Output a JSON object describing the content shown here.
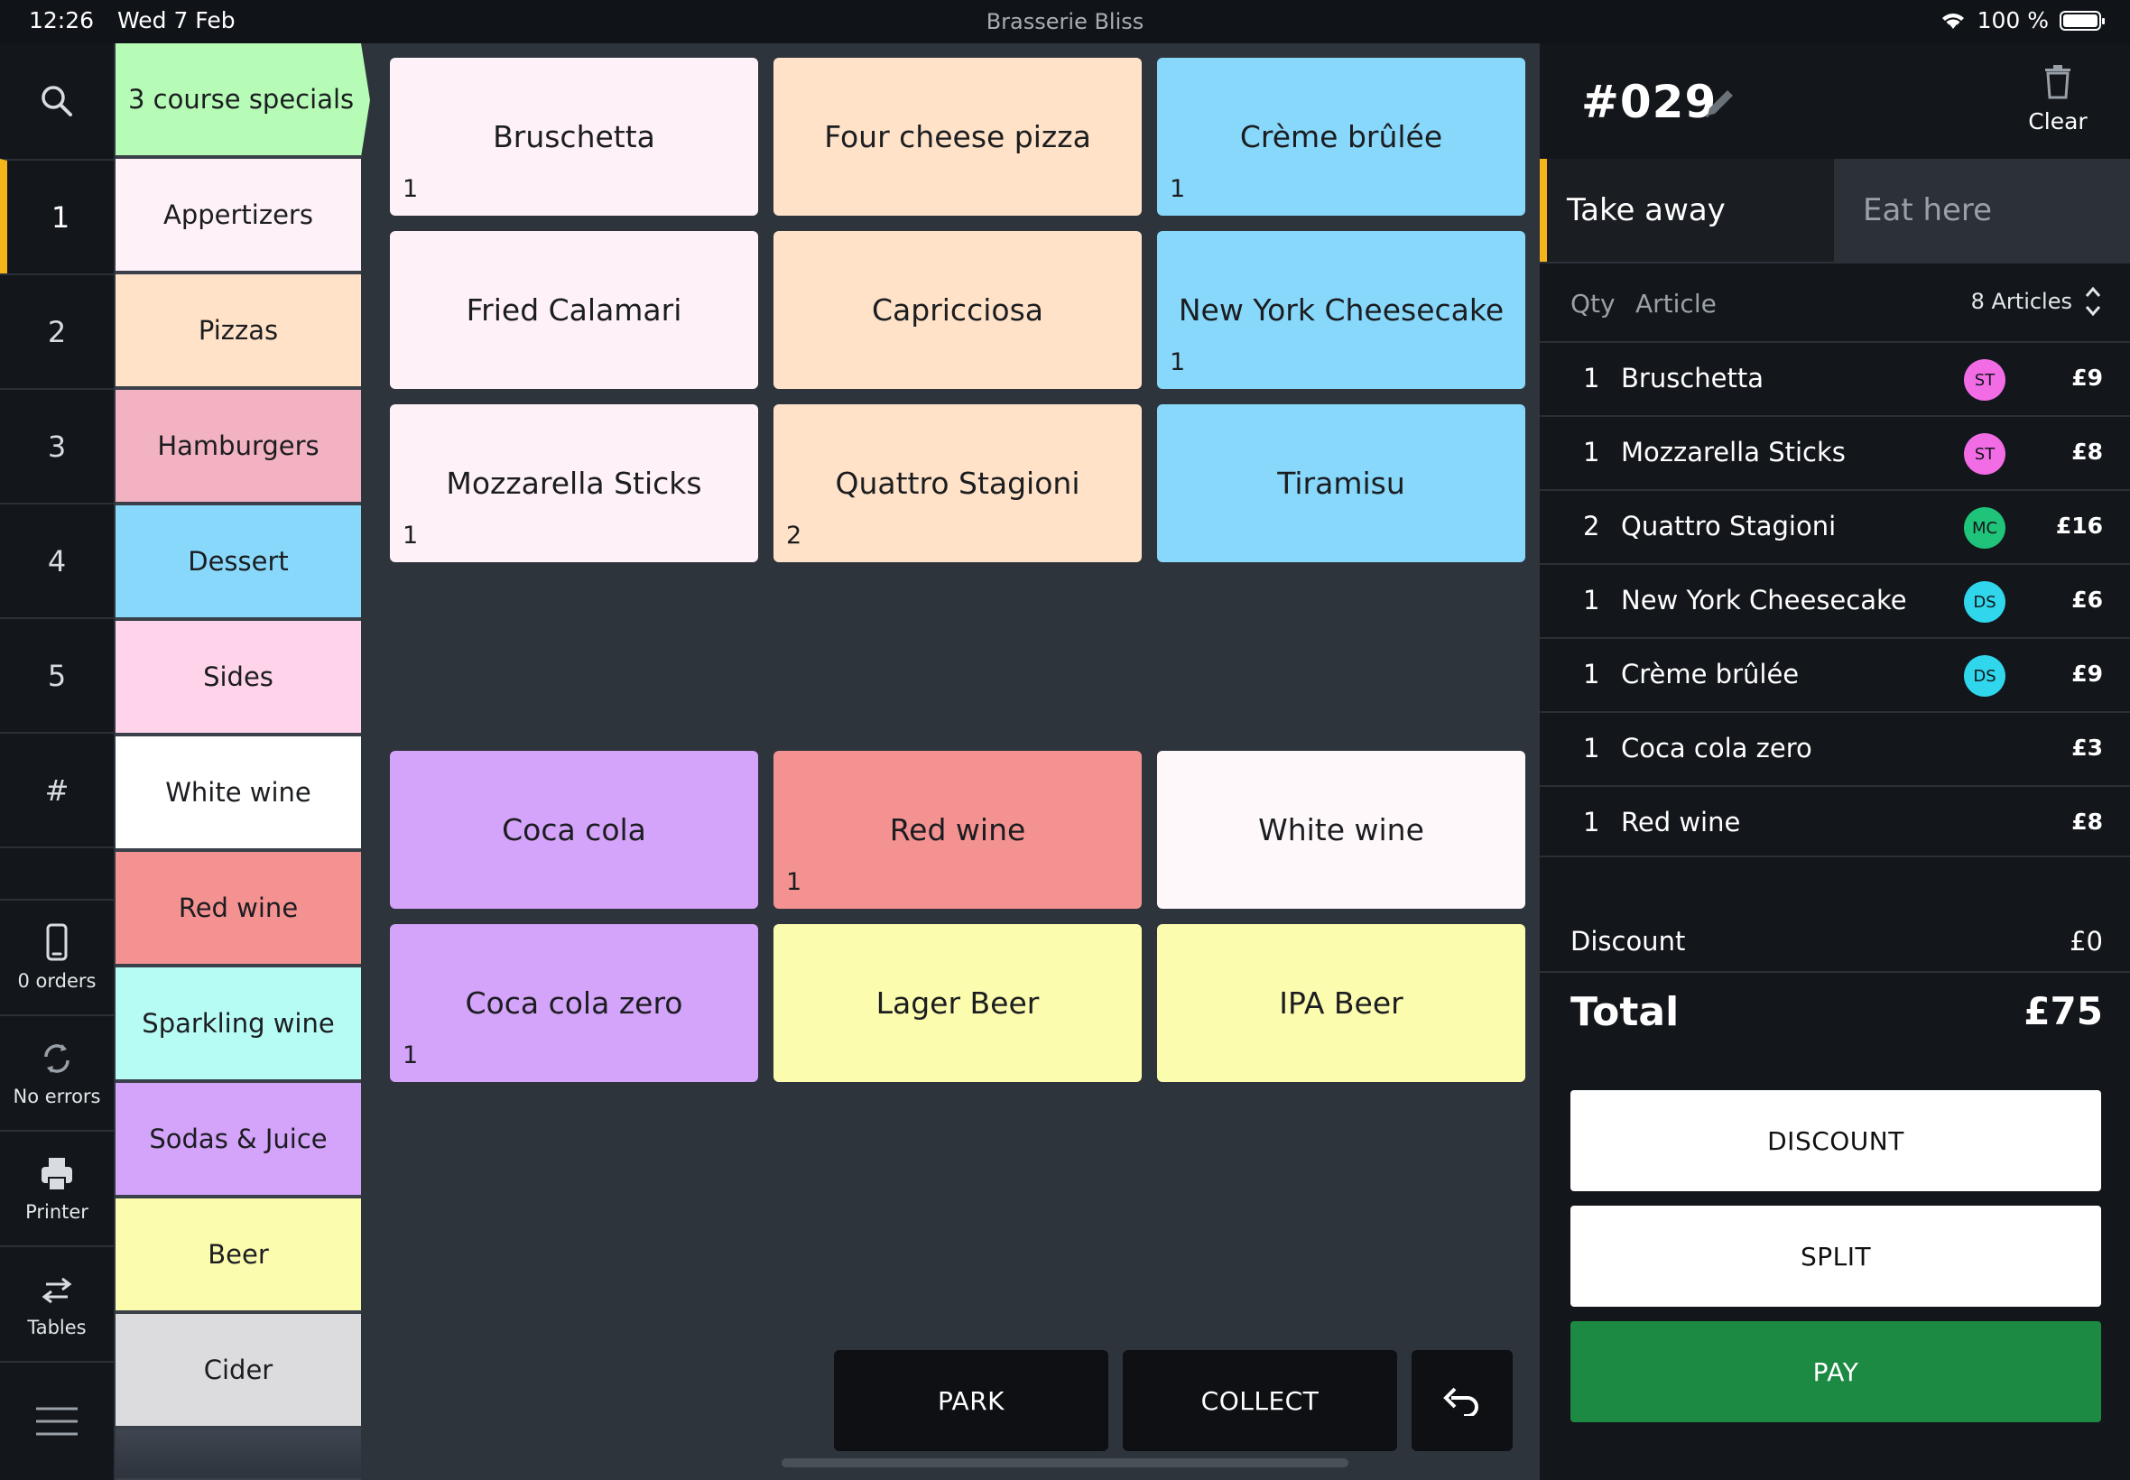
{
  "status_bar": {
    "time": "12:26",
    "date": "Wed 7 Feb",
    "app_name": "Brasserie Bliss",
    "battery": "100 %"
  },
  "rail": {
    "numbers": [
      "1",
      "2",
      "3",
      "4",
      "5",
      "#"
    ],
    "active_number": "1",
    "orders_label": "0 orders",
    "errors_label": "No errors",
    "printer_label": "Printer",
    "tables_label": "Tables"
  },
  "categories": [
    {
      "label": "3 course specials",
      "color": "#b6fbb6",
      "active": true
    },
    {
      "label": "Appertizers",
      "color": "#fff1f8"
    },
    {
      "label": "Pizzas",
      "color": "#ffe2c8"
    },
    {
      "label": "Hamburgers",
      "color": "#f3b2c2"
    },
    {
      "label": "Dessert",
      "color": "#88d8fb"
    },
    {
      "label": "Sides",
      "color": "#ffd4ea"
    },
    {
      "label": "White wine",
      "color": "#ffffff"
    },
    {
      "label": "Red wine",
      "color": "#f49191"
    },
    {
      "label": "Sparkling wine",
      "color": "#b7fcf4"
    },
    {
      "label": "Sodas & Juice",
      "color": "#d4a3fa"
    },
    {
      "label": "Beer",
      "color": "#fcfcaf"
    },
    {
      "label": "Cider",
      "color": "#dcdcdf"
    }
  ],
  "products": [
    {
      "name": "Bruschetta",
      "qty": "1",
      "color": "#fff1f8"
    },
    {
      "name": "Four cheese pizza",
      "qty": "",
      "color": "#ffe2c8"
    },
    {
      "name": "Crème brûlée",
      "qty": "1",
      "color": "#88d8fb"
    },
    {
      "name": "Fried Calamari",
      "qty": "",
      "color": "#fff1f8"
    },
    {
      "name": "Capricciosa",
      "qty": "",
      "color": "#ffe2c8"
    },
    {
      "name": "New York Cheesecake",
      "qty": "1",
      "color": "#88d8fb"
    },
    {
      "name": "Mozzarella Sticks",
      "qty": "1",
      "color": "#fff1f8"
    },
    {
      "name": "Quattro Stagioni",
      "qty": "2",
      "color": "#ffe2c8"
    },
    {
      "name": "Tiramisu",
      "qty": "",
      "color": "#88d8fb"
    },
    {
      "name": "Coca cola",
      "qty": "",
      "color": "#d4a3fa"
    },
    {
      "name": "Red wine",
      "qty": "1",
      "color": "#f49191"
    },
    {
      "name": "White wine",
      "qty": "",
      "color": "#fff8fa"
    },
    {
      "name": "Coca cola zero",
      "qty": "1",
      "color": "#d4a3fa"
    },
    {
      "name": "Lager Beer",
      "qty": "",
      "color": "#fcfcaf"
    },
    {
      "name": "IPA Beer",
      "qty": "",
      "color": "#fcfcaf"
    }
  ],
  "actions": {
    "park": "PARK",
    "collect": "COLLECT"
  },
  "order": {
    "number": "#029",
    "clear_label": "Clear",
    "modes": {
      "take_away": "Take away",
      "eat_here": "Eat here"
    },
    "header": {
      "qty": "Qty",
      "article": "Article",
      "count": "8 Articles"
    },
    "lines": [
      {
        "qty": "1",
        "article": "Bruschetta",
        "badge": "ST",
        "badge_color": "#f26ce6",
        "price": "£9"
      },
      {
        "qty": "1",
        "article": "Mozzarella Sticks",
        "badge": "ST",
        "badge_color": "#f26ce6",
        "price": "£8"
      },
      {
        "qty": "2",
        "article": "Quattro Stagioni",
        "badge": "MC",
        "badge_color": "#1fc47a",
        "price": "£16"
      },
      {
        "qty": "1",
        "article": "New York Cheesecake",
        "badge": "DS",
        "badge_color": "#2fd6ec",
        "price": "£6"
      },
      {
        "qty": "1",
        "article": "Crème brûlée",
        "badge": "DS",
        "badge_color": "#2fd6ec",
        "price": "£9"
      },
      {
        "qty": "1",
        "article": "Coca cola zero",
        "badge": "",
        "badge_color": "",
        "price": "£3"
      },
      {
        "qty": "1",
        "article": "Red wine",
        "badge": "",
        "badge_color": "",
        "price": "£8"
      }
    ],
    "discount_label": "Discount",
    "discount_value": "£0",
    "total_label": "Total",
    "total_value": "£75",
    "buttons": {
      "discount": "DISCOUNT",
      "split": "SPLIT",
      "pay": "PAY"
    }
  },
  "colors": {
    "accent": "#f4b41a",
    "pay": "#1c8a42",
    "background": "#2e343c",
    "panel": "#13161b"
  }
}
